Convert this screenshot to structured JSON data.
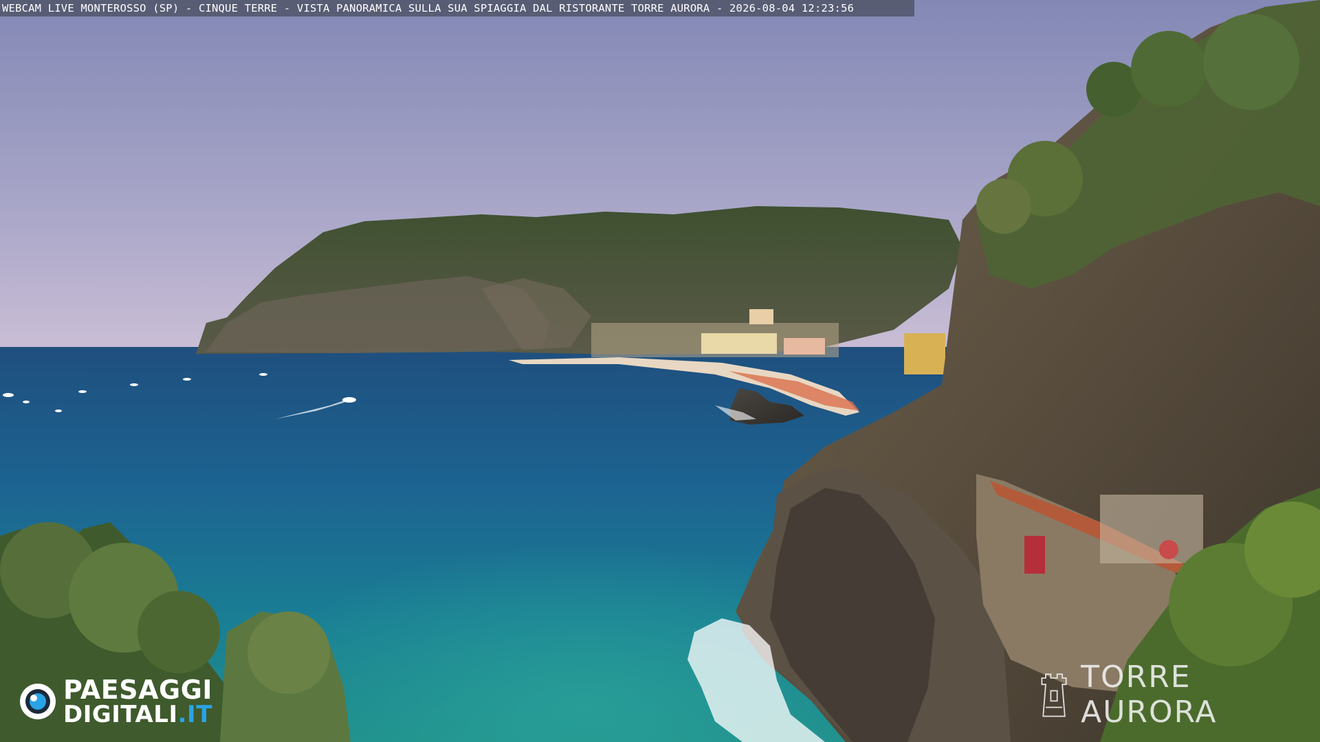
{
  "overlay": {
    "caption": "WEBCAM LIVE MONTEROSSO (SP) - CINQUE TERRE - VISTA PANORAMICA SULLA SUA SPIAGGIA DAL RISTORANTE TORRE AURORA - 2026-08-04 12:23:56"
  },
  "logo": {
    "line1": "PAESAGGI",
    "line2_main": "DIGITALI",
    "line2_accent": ".IT",
    "icon": "eye-camera-icon"
  },
  "watermark": {
    "text": "TORRE AURORA",
    "icon": "tower-icon"
  },
  "colors": {
    "sky_top": "#8a8fb8",
    "sky_horizon": "#c9bfd8",
    "sea_deep": "#1d5b86",
    "sea_shallow": "#1d8f9a",
    "logo_accent": "#2aa3e6"
  }
}
